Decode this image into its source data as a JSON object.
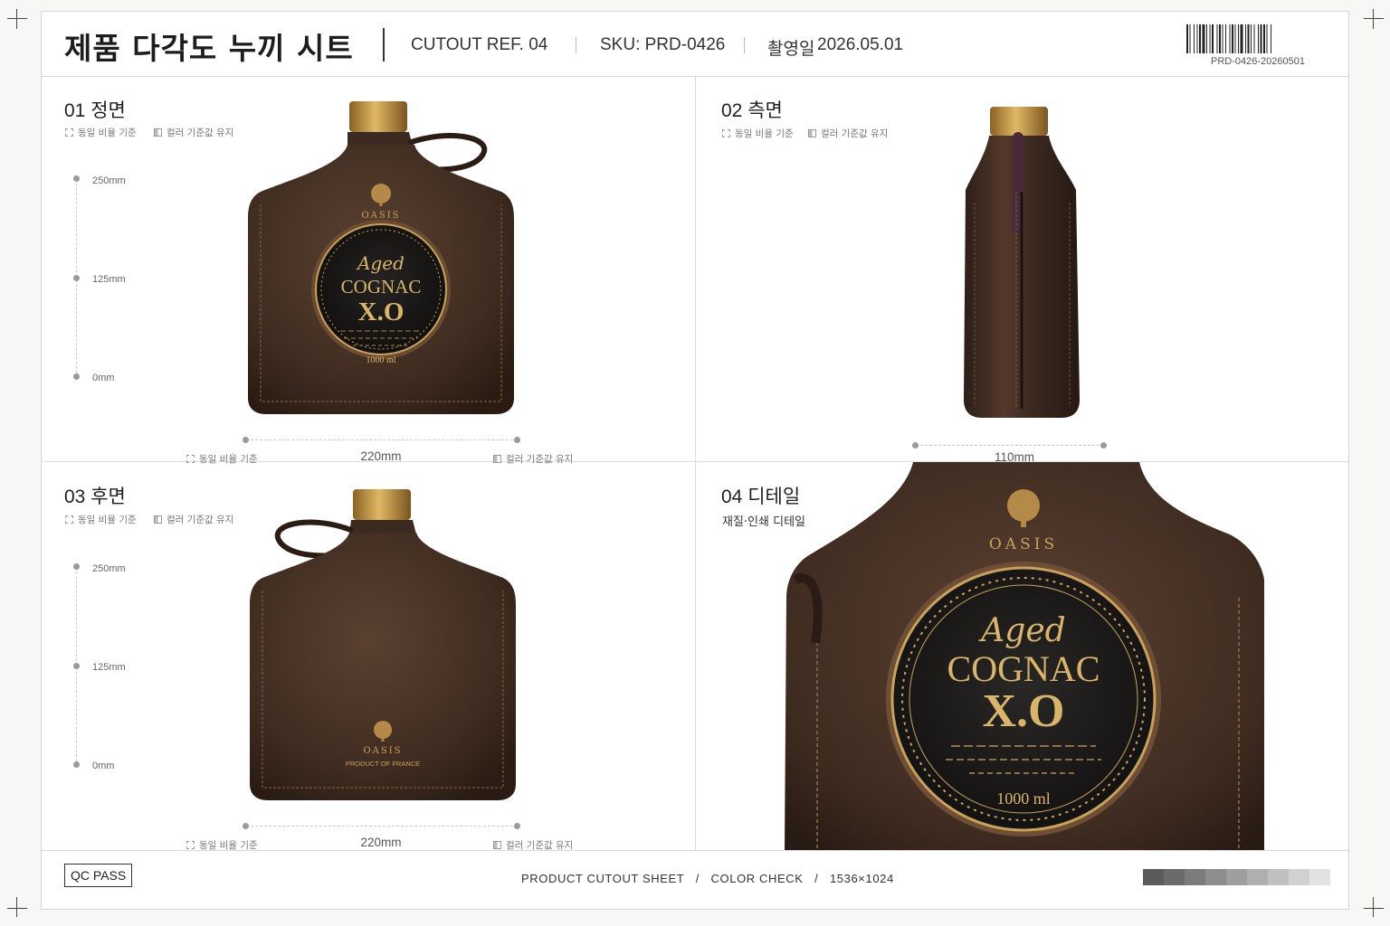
{
  "header": {
    "title": "제품 다각도 누끼 시트",
    "cutout_ref": "CUTOUT REF. 04",
    "sku": "SKU: PRD-0426",
    "shoot_date_label": "촬영일",
    "shoot_date": "2026.05.01",
    "barcode_text": "PRD-0426-20260501"
  },
  "badges": {
    "ratio": "동일 비율 기준",
    "color": "컬러 기준값 유지"
  },
  "panels": {
    "front": {
      "title": "01 정면",
      "ticks": [
        "250mm",
        "125mm",
        "0mm"
      ],
      "width_dim": "220mm"
    },
    "side": {
      "title": "02 측면",
      "width_dim": "110mm"
    },
    "back": {
      "title": "03 후면",
      "ticks": [
        "250mm",
        "125mm",
        "0mm"
      ],
      "width_dim": "220mm"
    },
    "detail": {
      "title": "04 디테일",
      "subtitle": "재질·인쇄 디테일"
    }
  },
  "label": {
    "brand": "OASIS",
    "aged": "Aged",
    "cognac": "COGNAC",
    "grade": "X.O",
    "volume": "1000 ml",
    "origin": "PRODUCT OF FRANCE"
  },
  "footer": {
    "qc": "QC PASS",
    "info": "PRODUCT CUTOUT SHEET   /   COLOR CHECK   /   1536×1024"
  },
  "colors": {
    "leather": "#4a3427",
    "leather_dark": "#2e1f16",
    "stitch": "#8c6a4a",
    "gold": "#c9a25a",
    "cap": "#b88a3e",
    "label_black": "#1b1a18",
    "grays": [
      "#5a5a5a",
      "#6b6b6b",
      "#7c7c7c",
      "#8d8d8d",
      "#9e9e9e",
      "#afafaf",
      "#c0c0c0",
      "#d1d1d1",
      "#e2e2e2"
    ]
  }
}
